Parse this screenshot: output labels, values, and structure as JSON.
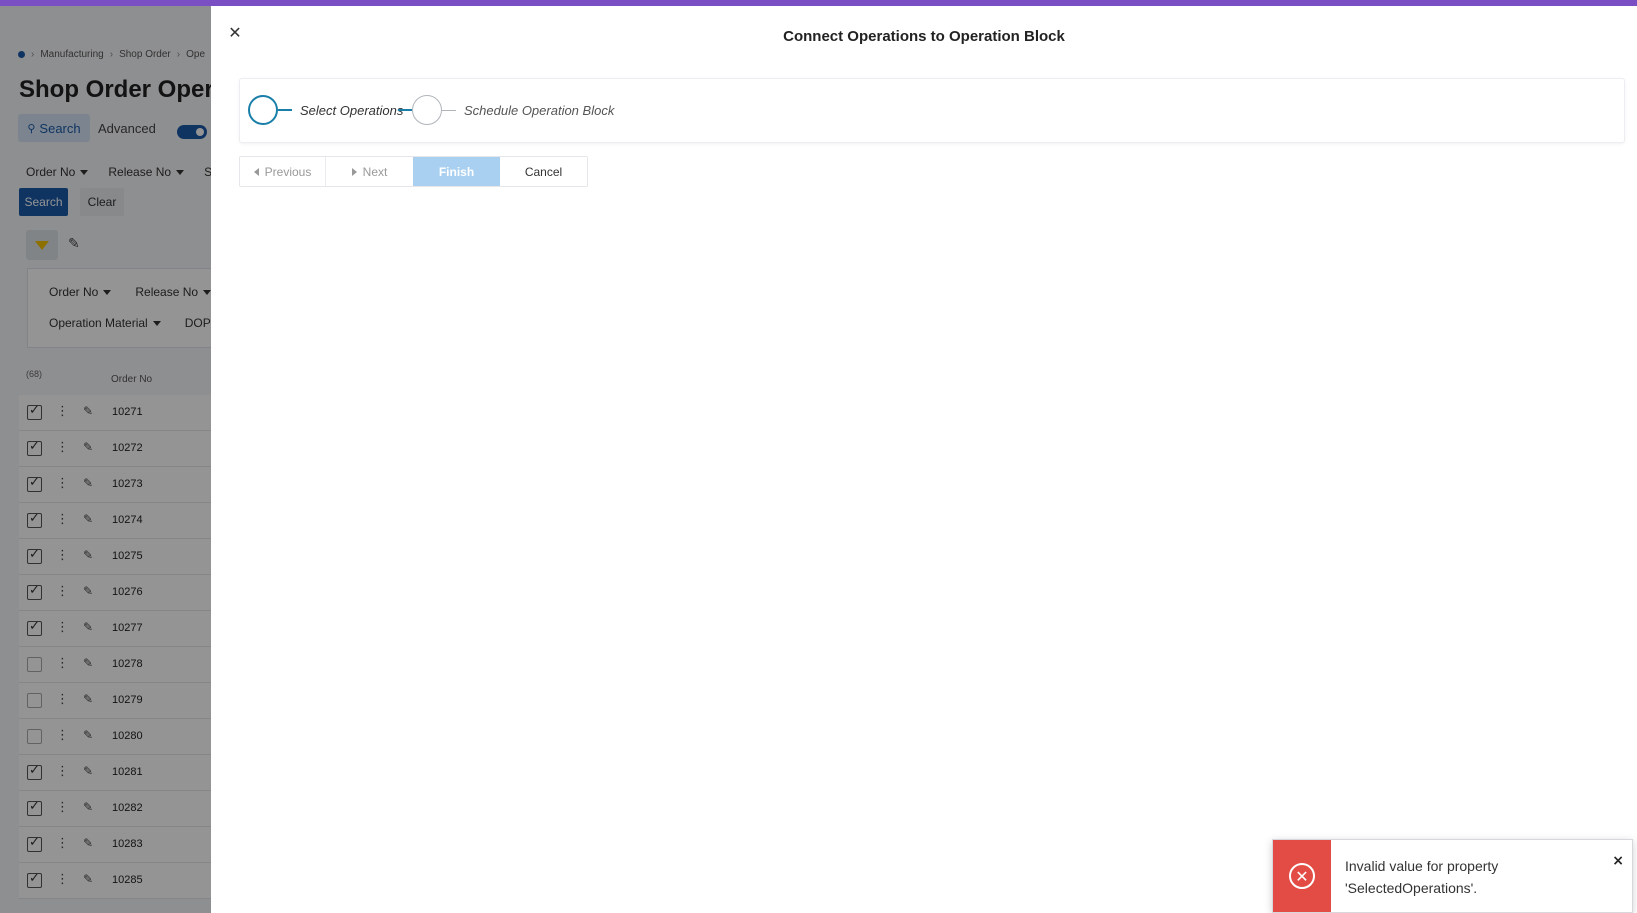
{
  "background": {
    "breadcrumb": [
      "Manufacturing",
      "Shop Order",
      "Ope"
    ],
    "page_title": "Shop Order Oper",
    "search_tab_label": "Search",
    "advanced_label": "Advanced",
    "filters": [
      "Order No",
      "Release No",
      "S"
    ],
    "search_button": "Search",
    "clear_button": "Clear",
    "group_row1": [
      "Order No",
      "Release No"
    ],
    "group_row2": [
      "Operation Material",
      "DOP"
    ],
    "record_count": "(68)",
    "column_order_no": "Order No",
    "rows": [
      {
        "order": "10271",
        "checked": true
      },
      {
        "order": "10272",
        "checked": true
      },
      {
        "order": "10273",
        "checked": true
      },
      {
        "order": "10274",
        "checked": true
      },
      {
        "order": "10275",
        "checked": true
      },
      {
        "order": "10276",
        "checked": true
      },
      {
        "order": "10277",
        "checked": true
      },
      {
        "order": "10278",
        "checked": false
      },
      {
        "order": "10279",
        "checked": false
      },
      {
        "order": "10280",
        "checked": false
      },
      {
        "order": "10281",
        "checked": true
      },
      {
        "order": "10282",
        "checked": true
      },
      {
        "order": "10283",
        "checked": true
      },
      {
        "order": "10285",
        "checked": true
      }
    ]
  },
  "dialog": {
    "title": "Connect Operations to Operation Block",
    "steps": [
      {
        "label": "Select Operations",
        "active": true
      },
      {
        "label": "Schedule Operation Block",
        "active": false
      }
    ],
    "buttons": {
      "previous": "Previous",
      "next": "Next",
      "finish": "Finish",
      "cancel": "Cancel"
    }
  },
  "toast": {
    "message_line1": "Invalid value for property",
    "message_line2": "'SelectedOperations'.",
    "close_glyph": "×"
  },
  "colors": {
    "accent_bar": "#7a4fc4",
    "primary": "#1a5aa8",
    "step_active": "#1a7fa8",
    "finish_disabled": "#a9d0f0",
    "error": "#e24c44"
  }
}
